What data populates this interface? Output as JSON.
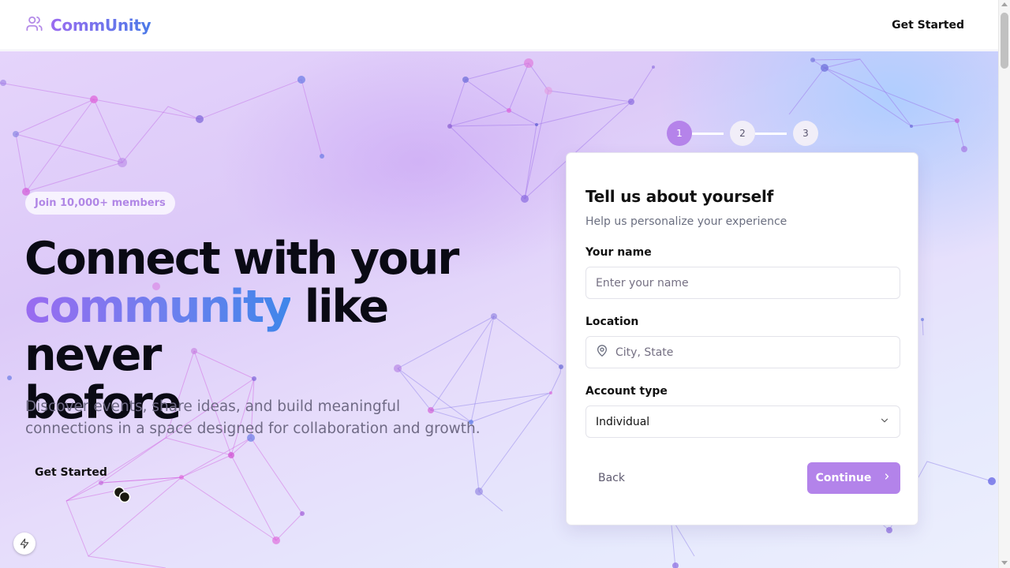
{
  "header": {
    "brand_name": "CommUnity",
    "brand_icon": "users-icon",
    "cta_label": "Get Started"
  },
  "hero": {
    "badge": "Join 10,000+ members",
    "headline_part1": "Connect with your",
    "headline_highlight": "community",
    "headline_part2": "like never",
    "headline_part3": "before",
    "subtext": "Discover events, share ideas, and build meaningful connections in a space designed for collaboration and growth.",
    "cta_label": "Get Started"
  },
  "stepper": {
    "steps": [
      "1",
      "2",
      "3"
    ],
    "current": 1
  },
  "form": {
    "title": "Tell us about yourself",
    "subtitle": "Help us personalize your experience",
    "name_label": "Your name",
    "name_placeholder": "Enter your name",
    "name_value": "",
    "location_label": "Location",
    "location_placeholder": "City, State",
    "location_value": "",
    "location_icon": "map-pin-icon",
    "account_type_label": "Account type",
    "account_type_value": "Individual",
    "back_label": "Back",
    "continue_label": "Continue"
  },
  "colors": {
    "accent": "#b383ea",
    "brand_gradient_start": "#9b6cf0",
    "brand_gradient_end": "#4b7ae8",
    "text": "#0a0a14",
    "muted": "#6f6a85"
  }
}
